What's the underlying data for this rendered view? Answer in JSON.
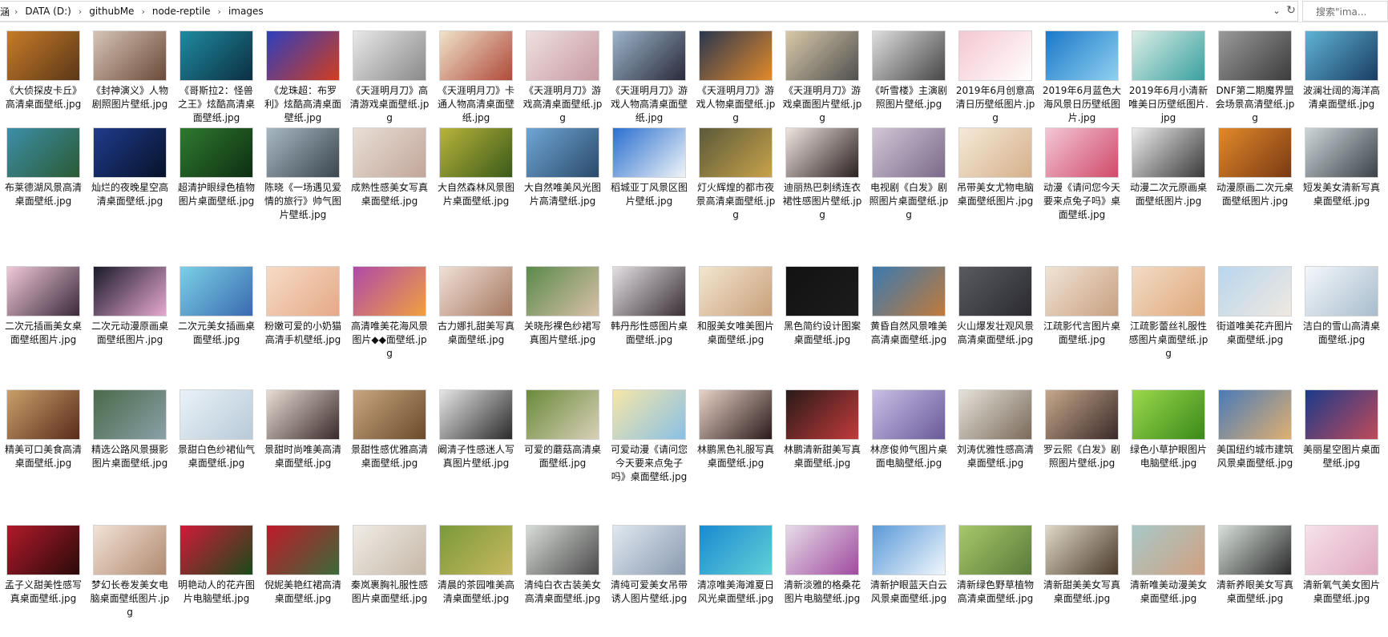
{
  "breadcrumbs": [
    "DATA (D:)",
    "githubMe",
    "node-reptile",
    "images"
  ],
  "breadcrumb_first_fragment": "涵",
  "search": {
    "placeholder": "搜索\"ima..."
  },
  "files": [
    {
      "name": "《大侦探皮卡丘》高清桌面壁纸.jpg",
      "colors": [
        "#c77b27",
        "#5b3718"
      ]
    },
    {
      "name": "《封神演义》人物剧照图片壁纸.jpg",
      "colors": [
        "#d7c4b5",
        "#6a4a3a"
      ]
    },
    {
      "name": "《哥斯拉2：怪兽之王》炫酷高清桌面壁纸.jpg",
      "colors": [
        "#1f8aa0",
        "#0c2f42"
      ]
    },
    {
      "name": "《龙珠超：布罗利》炫酷高清桌面壁纸.jpg",
      "colors": [
        "#2c3fbf",
        "#d23d1f"
      ]
    },
    {
      "name": "《天涯明月刀》高清游戏桌面壁纸.jpg",
      "colors": [
        "#e8e8e8",
        "#8a8a8a"
      ]
    },
    {
      "name": "《天涯明月刀》卡通人物高清桌面壁纸.jpg",
      "colors": [
        "#f0e2c9",
        "#b04a3a"
      ]
    },
    {
      "name": "《天涯明月刀》游戏高清桌面壁纸.jpg",
      "colors": [
        "#efe0e0",
        "#c79aa2"
      ]
    },
    {
      "name": "《天涯明月刀》游戏人物高清桌面壁纸.jpg",
      "colors": [
        "#9bb4c9",
        "#2a2a3a"
      ]
    },
    {
      "name": "《天涯明月刀》游戏人物桌面壁纸.jpg",
      "colors": [
        "#2a3650",
        "#e28a2a"
      ]
    },
    {
      "name": "《天涯明月刀》游戏桌面图片壁纸.jpg",
      "colors": [
        "#d9c9a8",
        "#505050"
      ]
    },
    {
      "name": "《听雪楼》主演剧照图片壁纸.jpg",
      "colors": [
        "#dedede",
        "#474747"
      ]
    },
    {
      "name": "2019年6月创意高清日历壁纸图片.jpg",
      "colors": [
        "#f4c7d1",
        "#ffffff"
      ]
    },
    {
      "name": "2019年6月蓝色大海风景日历壁纸图片.jpg",
      "colors": [
        "#1a78c9",
        "#8fd0f0"
      ]
    },
    {
      "name": "2019年6月小清新唯美日历壁纸图片.jpg",
      "colors": [
        "#dbeee5",
        "#3aa0a0"
      ]
    },
    {
      "name": "DNF第二期魔界盟会场景高清壁纸.jpg",
      "colors": [
        "#9a9a9a",
        "#3c3c3c"
      ]
    },
    {
      "name": "波澜壮阔的海洋高清桌面壁纸.jpg",
      "colors": [
        "#5fb3d6",
        "#1a3d63"
      ]
    },
    {
      "name": "布莱德湖风景高清桌面壁纸.jpg",
      "colors": [
        "#3c8fa8",
        "#2a5a34"
      ]
    },
    {
      "name": "灿烂的夜晚星空高清桌面壁纸.jpg",
      "colors": [
        "#1f3b8c",
        "#071229"
      ]
    },
    {
      "name": "超清护眼绿色植物图片桌面壁纸.jpg",
      "colors": [
        "#2e7a2e",
        "#0e2e12"
      ]
    },
    {
      "name": "陈晓《一场遇见爱情的旅行》帅气图片壁纸.jpg",
      "colors": [
        "#a8b8c2",
        "#3a4650"
      ]
    },
    {
      "name": "成熟性感美女写真桌面壁纸.jpg",
      "colors": [
        "#e8dfd6",
        "#c2a69a"
      ]
    },
    {
      "name": "大自然森林风景图片桌面壁纸.jpg",
      "colors": [
        "#b8b43a",
        "#3a5a1a"
      ]
    },
    {
      "name": "大自然唯美风光图片高清壁纸.jpg",
      "colors": [
        "#6fa6d6",
        "#2a4a6a"
      ]
    },
    {
      "name": "稻城亚丁风景区图片壁纸.jpg",
      "colors": [
        "#2a6fd0",
        "#f0f4f8"
      ]
    },
    {
      "name": "灯火辉煌的都市夜景高清桌面壁纸.jpg",
      "colors": [
        "#5a5a3a",
        "#c9a24a"
      ]
    },
    {
      "name": "迪丽热巴刺绣连衣裙性感图片壁纸.jpg",
      "colors": [
        "#efe4df",
        "#2a2020"
      ]
    },
    {
      "name": "电视剧《白发》剧照图片桌面壁纸.jpg",
      "colors": [
        "#d2c6d6",
        "#7a6a8a"
      ]
    },
    {
      "name": "吊带美女尤物电脑桌面壁纸图片.jpg",
      "colors": [
        "#f4ead8",
        "#d6b08a"
      ]
    },
    {
      "name": "动漫《请问您今天要来点兔子吗》桌面壁纸.jpg",
      "colors": [
        "#f3c6d6",
        "#d04a6a"
      ]
    },
    {
      "name": "动漫二次元原画桌面壁纸图片.jpg",
      "colors": [
        "#ececec",
        "#3a3a3a"
      ]
    },
    {
      "name": "动漫原画二次元桌面壁纸图片.jpg",
      "colors": [
        "#e2892a",
        "#7a3a12"
      ]
    },
    {
      "name": "短发美女清新写真桌面壁纸.jpg",
      "colors": [
        "#cfd6da",
        "#3a4248"
      ]
    },
    {
      "name": "二次元插画美女桌面壁纸图片.jpg",
      "colors": [
        "#f0c8d8",
        "#3a2a3a"
      ]
    },
    {
      "name": "二次元动漫原画桌面壁纸图片.jpg",
      "colors": [
        "#1a1a2a",
        "#e6a8d0"
      ]
    },
    {
      "name": "二次元美女插画桌面壁纸.jpg",
      "colors": [
        "#7ad0e6",
        "#3a6ab0"
      ]
    },
    {
      "name": "粉嫩可爱的小奶猫高清手机壁纸.jpg",
      "colors": [
        "#f6dcc6",
        "#e6a886"
      ]
    },
    {
      "name": "高清唯美花海风景图片◆◆面壁纸.jpg",
      "colors": [
        "#b04aa8",
        "#f0a040"
      ]
    },
    {
      "name": "古力娜扎甜美写真桌面壁纸.jpg",
      "colors": [
        "#f0e0d6",
        "#a67860"
      ]
    },
    {
      "name": "关晓彤裸色纱裙写真图片壁纸.jpg",
      "colors": [
        "#5a8a4a",
        "#d8c0a8"
      ]
    },
    {
      "name": "韩丹彤性感图片桌面壁纸.jpg",
      "colors": [
        "#e2dfe2",
        "#3a3036"
      ]
    },
    {
      "name": "和服美女唯美图片桌面壁纸.jpg",
      "colors": [
        "#f2e6d0",
        "#c9a07a"
      ]
    },
    {
      "name": "黑色简约设计图案桌面壁纸.jpg",
      "colors": [
        "#121212",
        "#1c1c1c"
      ]
    },
    {
      "name": "黄昏自然风景唯美高清桌面壁纸.jpg",
      "colors": [
        "#3a7ab0",
        "#c27a3a"
      ]
    },
    {
      "name": "火山爆发壮观风景高清桌面壁纸.jpg",
      "colors": [
        "#5a5a62",
        "#2a2a30"
      ]
    },
    {
      "name": "江疏影代言图片桌面壁纸.jpg",
      "colors": [
        "#f0e4d6",
        "#c9a080"
      ]
    },
    {
      "name": "江疏影蕾丝礼服性感图片桌面壁纸.jpg",
      "colors": [
        "#f2dcc6",
        "#e0a87a"
      ]
    },
    {
      "name": "街道唯美花卉图片桌面壁纸.jpg",
      "colors": [
        "#b8d6ee",
        "#f0e8e0"
      ]
    },
    {
      "name": "洁白的雪山高清桌面壁纸.jpg",
      "colors": [
        "#f4f8fc",
        "#a8bccc"
      ]
    },
    {
      "name": "精美可口美食高清桌面壁纸.jpg",
      "colors": [
        "#c9a06a",
        "#5a2a1a"
      ]
    },
    {
      "name": "精选公路风景摄影图片桌面壁纸.jpg",
      "colors": [
        "#4a6a4a",
        "#8aa0a8"
      ]
    },
    {
      "name": "景甜白色纱裙仙气桌面壁纸.jpg",
      "colors": [
        "#eaf2f8",
        "#b8cad8"
      ]
    },
    {
      "name": "景甜时尚唯美高清桌面壁纸.jpg",
      "colors": [
        "#e8dcd4",
        "#3a2a2a"
      ]
    },
    {
      "name": "景甜性感优雅高清桌面壁纸.jpg",
      "colors": [
        "#c9a680",
        "#6a4a2a"
      ]
    },
    {
      "name": "阚清子性感迷人写真图片壁纸.jpg",
      "colors": [
        "#e6e6e6",
        "#2a2a2a"
      ]
    },
    {
      "name": "可爱的蘑菇高清桌面壁纸.jpg",
      "colors": [
        "#6a8a3a",
        "#d8d0b8"
      ]
    },
    {
      "name": "可爱动漫《请问您今天要来点兔子吗》桌面壁纸.jpg",
      "colors": [
        "#f6e6a8",
        "#8ac0e6"
      ]
    },
    {
      "name": "林鹏黑色礼服写真桌面壁纸.jpg",
      "colors": [
        "#e8d2c6",
        "#2a1a1a"
      ]
    },
    {
      "name": "林鹏清新甜美写真桌面壁纸.jpg",
      "colors": [
        "#2a1a1a",
        "#c23a3a"
      ]
    },
    {
      "name": "林彦俊帅气图片桌面电脑壁纸.jpg",
      "colors": [
        "#c8bee6",
        "#6a5a9a"
      ]
    },
    {
      "name": "刘涛优雅性感高清桌面壁纸.jpg",
      "colors": [
        "#e6e2da",
        "#7a6a5a"
      ]
    },
    {
      "name": "罗云熙《白发》剧照图片壁纸.jpg",
      "colors": [
        "#c6a88a",
        "#3a2a2a"
      ]
    },
    {
      "name": "绿色小草护眼图片电脑壁纸.jpg",
      "colors": [
        "#9ad84a",
        "#3a8a1a"
      ]
    },
    {
      "name": "美国纽约城市建筑风景桌面壁纸.jpg",
      "colors": [
        "#4a7ab8",
        "#e0b070"
      ]
    },
    {
      "name": "美丽星空图片桌面壁纸.jpg",
      "colors": [
        "#1a3a8a",
        "#c04a5a"
      ]
    },
    {
      "name": "孟子义甜美性感写真桌面壁纸.jpg",
      "colors": [
        "#b01a2a",
        "#2a0a0a"
      ]
    },
    {
      "name": "梦幻长卷发美女电脑桌面壁纸图片.jpg",
      "colors": [
        "#f2e2d6",
        "#b08a70"
      ]
    },
    {
      "name": "明艳动人的花卉图片电脑壁纸.jpg",
      "colors": [
        "#d01a3a",
        "#1a4a1a"
      ]
    },
    {
      "name": "倪妮美艳红裙高清桌面壁纸.jpg",
      "colors": [
        "#c01a2a",
        "#3a6a3a"
      ]
    },
    {
      "name": "秦岚裹胸礼服性感图片桌面壁纸.jpg",
      "colors": [
        "#f0ece6",
        "#c6b8a8"
      ]
    },
    {
      "name": "清晨的茶园唯美高清桌面壁纸.jpg",
      "colors": [
        "#7a9a3a",
        "#c8b860"
      ]
    },
    {
      "name": "清纯白衣古装美女高清桌面壁纸.jpg",
      "colors": [
        "#d8dcd8",
        "#4a4a4a"
      ]
    },
    {
      "name": "清纯可爱美女吊带诱人图片壁纸.jpg",
      "colors": [
        "#e0e8f0",
        "#8a9ab0"
      ]
    },
    {
      "name": "清凉唯美海滩夏日风光桌面壁纸.jpg",
      "colors": [
        "#1a8ad0",
        "#60d0d8"
      ]
    },
    {
      "name": "清新淡雅的格桑花图片电脑壁纸.jpg",
      "colors": [
        "#e6dce6",
        "#a04aa0"
      ]
    },
    {
      "name": "清新护眼蓝天白云风景桌面壁纸.jpg",
      "colors": [
        "#5a9ad8",
        "#f0f6fc"
      ]
    },
    {
      "name": "清新绿色野草植物高清桌面壁纸.jpg",
      "colors": [
        "#a8c86a",
        "#5a7a3a"
      ]
    },
    {
      "name": "清新甜美美女写真桌面壁纸.jpg",
      "colors": [
        "#e0d8c8",
        "#4a3a2a"
      ]
    },
    {
      "name": "清新唯美动漫美女桌面壁纸.jpg",
      "colors": [
        "#a8c8c8",
        "#d0a080"
      ]
    },
    {
      "name": "清新养眼美女写真桌面壁纸.jpg",
      "colors": [
        "#d8e0da",
        "#2a2a2a"
      ]
    },
    {
      "name": "清新氧气美女图片桌面壁纸.jpg",
      "colors": [
        "#f6e2ea",
        "#e0a8c0"
      ]
    }
  ]
}
